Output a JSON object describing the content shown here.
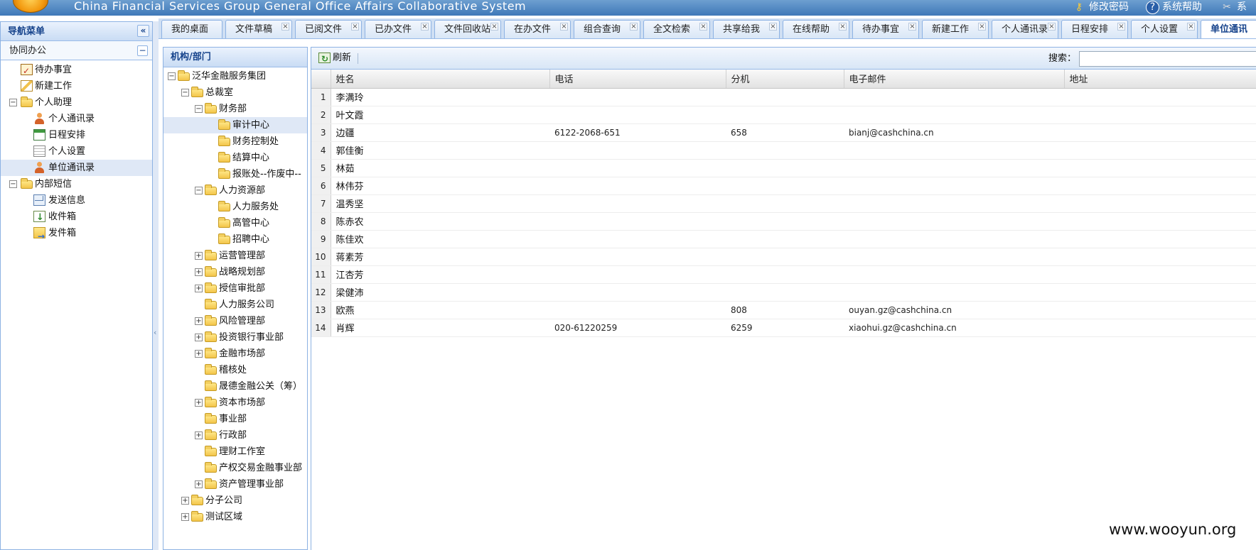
{
  "header": {
    "title": "China Financial Services Group General Office Affairs Collaborative System",
    "links": {
      "change_password": "修改密码",
      "system_help": "系统帮助",
      "system": "系统"
    }
  },
  "leftnav": {
    "title": "导航菜单",
    "section": "协同办公",
    "items": [
      {
        "label": "待办事宜"
      },
      {
        "label": "新建工作"
      },
      {
        "label": "个人助理"
      },
      {
        "label": "个人通讯录"
      },
      {
        "label": "日程安排"
      },
      {
        "label": "个人设置"
      },
      {
        "label": "单位通讯录"
      },
      {
        "label": "内部短信"
      },
      {
        "label": "发送信息"
      },
      {
        "label": "收件箱"
      },
      {
        "label": "发件箱"
      }
    ]
  },
  "tabs": [
    {
      "label": "我的桌面"
    },
    {
      "label": "文件草稿"
    },
    {
      "label": "已阅文件"
    },
    {
      "label": "已办文件"
    },
    {
      "label": "文件回收站"
    },
    {
      "label": "在办文件"
    },
    {
      "label": "组合查询"
    },
    {
      "label": "全文检索"
    },
    {
      "label": "共享给我"
    },
    {
      "label": "在线帮助"
    },
    {
      "label": "待办事宜"
    },
    {
      "label": "新建工作"
    },
    {
      "label": "个人通讯录"
    },
    {
      "label": "日程安排"
    },
    {
      "label": "个人设置"
    },
    {
      "label": "单位通讯"
    }
  ],
  "org_tree": {
    "title": "机构/部门",
    "nodes": [
      {
        "label": "泛华金融服务集团"
      },
      {
        "label": "总裁室"
      },
      {
        "label": "财务部"
      },
      {
        "label": "审计中心"
      },
      {
        "label": "财务控制处"
      },
      {
        "label": "结算中心"
      },
      {
        "label": "报账处--作废中--"
      },
      {
        "label": "人力资源部"
      },
      {
        "label": "人力服务处"
      },
      {
        "label": "高管中心"
      },
      {
        "label": "招聘中心"
      },
      {
        "label": "运营管理部"
      },
      {
        "label": "战略规划部"
      },
      {
        "label": "授信审批部"
      },
      {
        "label": "人力服务公司"
      },
      {
        "label": "风险管理部"
      },
      {
        "label": "投资银行事业部"
      },
      {
        "label": "金融市场部"
      },
      {
        "label": "稽核处"
      },
      {
        "label": "晟德金融公关（筹）"
      },
      {
        "label": "资本市场部"
      },
      {
        "label": "事业部"
      },
      {
        "label": "行政部"
      },
      {
        "label": "理财工作室"
      },
      {
        "label": "产权交易金融事业部"
      },
      {
        "label": "资产管理事业部"
      },
      {
        "label": "分子公司"
      },
      {
        "label": "测试区域"
      }
    ]
  },
  "toolbar": {
    "refresh_label": "刷新",
    "search_label": "搜索：",
    "search_value": ""
  },
  "grid": {
    "columns": [
      "姓名",
      "电话",
      "分机",
      "电子邮件",
      "地址"
    ],
    "rows": [
      {
        "n": "1",
        "name": "李满玲",
        "phone": "",
        "ext": "",
        "email": "",
        "address": ""
      },
      {
        "n": "2",
        "name": "叶文霞",
        "phone": "",
        "ext": "",
        "email": "",
        "address": ""
      },
      {
        "n": "3",
        "name": "边疆",
        "phone": "6122-2068-651",
        "ext": "658",
        "email": "bianj@cashchina.cn",
        "address": ""
      },
      {
        "n": "4",
        "name": "郭佳衡",
        "phone": "",
        "ext": "",
        "email": "",
        "address": ""
      },
      {
        "n": "5",
        "name": "林茹",
        "phone": "",
        "ext": "",
        "email": "",
        "address": ""
      },
      {
        "n": "6",
        "name": "林伟芬",
        "phone": "",
        "ext": "",
        "email": "",
        "address": ""
      },
      {
        "n": "7",
        "name": "温秀坚",
        "phone": "",
        "ext": "",
        "email": "",
        "address": ""
      },
      {
        "n": "8",
        "name": "陈赤农",
        "phone": "",
        "ext": "",
        "email": "",
        "address": ""
      },
      {
        "n": "9",
        "name": "陈佳欢",
        "phone": "",
        "ext": "",
        "email": "",
        "address": ""
      },
      {
        "n": "10",
        "name": "蒋素芳",
        "phone": "",
        "ext": "",
        "email": "",
        "address": ""
      },
      {
        "n": "11",
        "name": "江杏芳",
        "phone": "",
        "ext": "",
        "email": "",
        "address": ""
      },
      {
        "n": "12",
        "name": "梁健沛",
        "phone": "",
        "ext": "",
        "email": "",
        "address": ""
      },
      {
        "n": "13",
        "name": "欧燕",
        "phone": "",
        "ext": "808",
        "email": "ouyan.gz@cashchina.cn",
        "address": ""
      },
      {
        "n": "14",
        "name": "肖辉",
        "phone": "020-61220259",
        "ext": "6259",
        "email": "xiaohui.gz@cashchina.cn",
        "address": ""
      }
    ]
  },
  "watermark": "www.wooyun.org"
}
